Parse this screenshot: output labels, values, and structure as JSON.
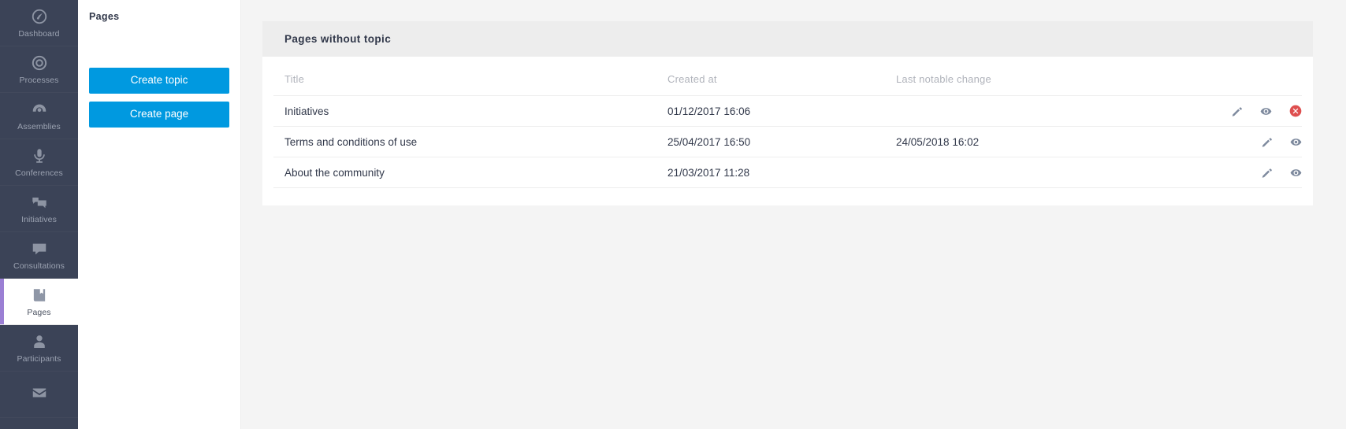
{
  "sidebar": {
    "items": [
      {
        "label": "Dashboard",
        "icon": "dashboard-icon",
        "active": false
      },
      {
        "label": "Processes",
        "icon": "target-icon",
        "active": false
      },
      {
        "label": "Assemblies",
        "icon": "assembly-icon",
        "active": false
      },
      {
        "label": "Conferences",
        "icon": "microphone-icon",
        "active": false
      },
      {
        "label": "Initiatives",
        "icon": "comments-icon",
        "active": false
      },
      {
        "label": "Consultations",
        "icon": "speech-bubble-icon",
        "active": false
      },
      {
        "label": "Pages",
        "icon": "book-icon",
        "active": true
      },
      {
        "label": "Participants",
        "icon": "user-icon",
        "active": false
      },
      {
        "label": "",
        "icon": "envelope-icon",
        "active": false
      }
    ],
    "accent_color": "#9b7fd4",
    "background_color": "#3b4357"
  },
  "panel": {
    "title": "Pages",
    "create_topic_label": "Create topic",
    "create_page_label": "Create page",
    "button_color": "#0099e0"
  },
  "card": {
    "header_title": "Pages without topic"
  },
  "table": {
    "columns": {
      "title": "Title",
      "created_at": "Created at",
      "last_notable_change": "Last notable change",
      "actions": ""
    },
    "rows": [
      {
        "title": "Initiatives",
        "created_at": "01/12/2017 16:06",
        "last_notable_change": "",
        "actions": [
          "edit",
          "view",
          "delete"
        ]
      },
      {
        "title": "Terms and conditions of use",
        "created_at": "25/04/2017 16:50",
        "last_notable_change": "24/05/2018 16:02",
        "actions": [
          "edit",
          "view"
        ]
      },
      {
        "title": "About the community",
        "created_at": "21/03/2017 11:28",
        "last_notable_change": "",
        "actions": [
          "edit",
          "view"
        ]
      }
    ]
  },
  "icons": {
    "edit_title": "Edit",
    "view_title": "Preview",
    "delete_title": "Delete"
  }
}
